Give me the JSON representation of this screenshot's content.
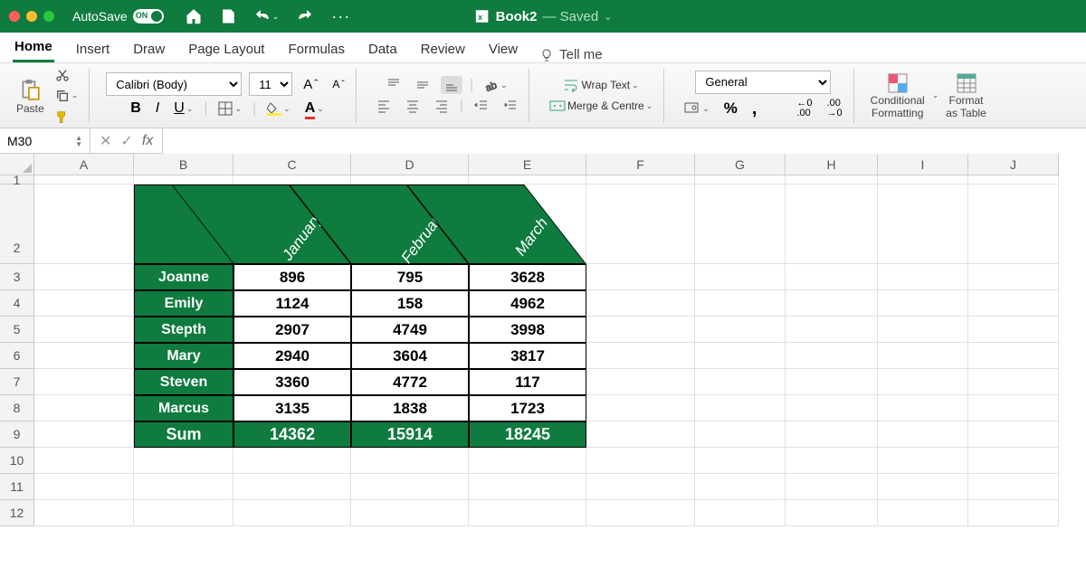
{
  "titlebar": {
    "autosave_label": "AutoSave",
    "autosave_state": "ON",
    "doc_name": "Book2",
    "doc_status": "Saved"
  },
  "tabs": [
    "Home",
    "Insert",
    "Draw",
    "Page Layout",
    "Formulas",
    "Data",
    "Review",
    "View"
  ],
  "active_tab": "Home",
  "tell_me": "Tell me",
  "ribbon": {
    "paste": "Paste",
    "font_name": "Calibri (Body)",
    "font_size": "11",
    "wrap": "Wrap Text",
    "merge": "Merge & Centre",
    "num_format": "General",
    "cond_fmt_l1": "Conditional",
    "cond_fmt_l2": "Formatting",
    "fmt_tbl_l1": "Format",
    "fmt_tbl_l2": "as Table"
  },
  "formula_bar": {
    "name_box": "M30",
    "formula": ""
  },
  "columns": [
    "A",
    "B",
    "C",
    "D",
    "E",
    "F",
    "G",
    "H",
    "I",
    "J"
  ],
  "rows": [
    "1",
    "2",
    "3",
    "4",
    "5",
    "6",
    "7",
    "8",
    "9",
    "10",
    "11",
    "12"
  ],
  "chart_data": {
    "type": "table",
    "months": [
      "January",
      "February",
      "March"
    ],
    "rows": [
      {
        "name": "Joanne",
        "values": [
          896,
          795,
          3628
        ]
      },
      {
        "name": "Emily",
        "values": [
          1124,
          158,
          4962
        ]
      },
      {
        "name": "Stepth",
        "values": [
          2907,
          4749,
          3998
        ]
      },
      {
        "name": "Mary",
        "values": [
          2940,
          3604,
          3817
        ]
      },
      {
        "name": "Steven",
        "values": [
          3360,
          4772,
          117
        ]
      },
      {
        "name": "Marcus",
        "values": [
          3135,
          1838,
          1723
        ]
      }
    ],
    "sum_label": "Sum",
    "sums": [
      14362,
      15914,
      18245
    ]
  }
}
